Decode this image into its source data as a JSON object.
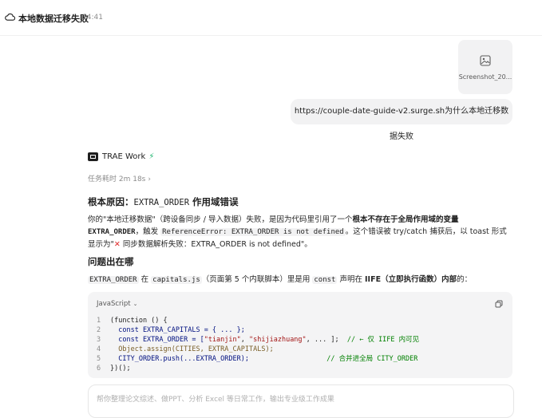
{
  "header": {
    "title": "本地数据迁移失败",
    "time": "14:41"
  },
  "attachment": {
    "filename": "Screenshot_20...",
    "icon": "image-icon"
  },
  "user_message": "https://couple-date-guide-v2.surge.sh为什么本地迁移数据失败",
  "agent": {
    "name": "TRAE Work",
    "duration": "任务耗时 2m 18s",
    "duration_chevron": "›"
  },
  "answer": {
    "h1_prefix": "根本原因：",
    "h1_code": "EXTRA_ORDER",
    "h1_suffix": " 作用域错误",
    "p1_a": "你的\"本地迁移数据\"（跨设备同步 / 导入数据）失败，是因为代码里引用了一个",
    "p1_b": "根本不存在于全局作用域的变量",
    "p1_c": "EXTRA_ORDER",
    "p1_d": "，触发 ",
    "p1_e": "ReferenceError: EXTRA_ORDER is not defined",
    "p1_f": "。这个错误被 try/catch 捕获后，以 toast 形式显示为\"",
    "p1_x": "✕",
    "p1_g": " 同步数据解析失败：EXTRA_ORDER is not defined\"。",
    "h2": "问题出在哪",
    "p2_a": "EXTRA_ORDER",
    "p2_b": " 在 ",
    "p2_c": "capitals.js",
    "p2_d": "（页面第 5 个内联脚本）里是用 ",
    "p2_e": "const",
    "p2_f": " 声明在 ",
    "p2_g": "IIFE（立即执行函数）内部",
    "p2_h": "的："
  },
  "code": {
    "language": "JavaScript",
    "lines": [
      {
        "n": "1",
        "t": "(function () {"
      },
      {
        "n": "2",
        "t": "  const EXTRA_CAPITALS = { ... };"
      },
      {
        "n": "3",
        "a": "  const EXTRA_ORDER = [",
        "s1": "\"tianjin\"",
        "b": ", ",
        "s2": "\"shijiazhuang\"",
        "c": ", ... ];  ",
        "cm": "// ← 仅 IIFE 内可见"
      },
      {
        "n": "4",
        "t": "  Object.assign(CITIES, EXTRA_CAPITALS);"
      },
      {
        "n": "5",
        "t": "  CITY_ORDER.push(...EXTRA_ORDER);",
        "cm": "                   // 合并进全局 CITY_ORDER"
      },
      {
        "n": "6",
        "t": "})();"
      }
    ]
  },
  "composer": {
    "placeholder": "帮你整理论文综述、做PPT、分析 Excel 等日常工作，输出专业级工作成果"
  },
  "colors": {
    "accent_green": "#19b36b",
    "error_red": "#e02b2b",
    "bubble_bg": "#f2f2f3"
  }
}
